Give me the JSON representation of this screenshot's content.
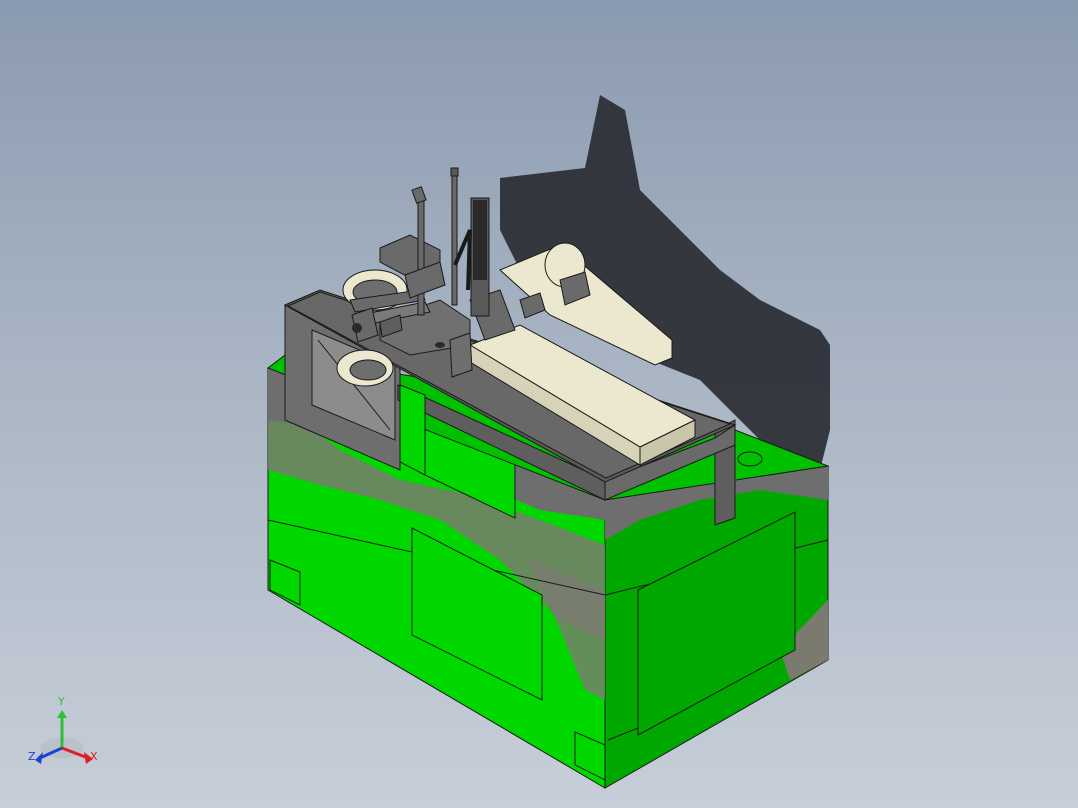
{
  "triad": {
    "y_label": "Y",
    "x_label": "X",
    "z_label": "Z",
    "y_color": "#2bbf3c",
    "x_color": "#e02020",
    "z_color": "#2040d0"
  },
  "model": {
    "base_color": "#00d800",
    "base_dark_color": "#009a00",
    "frame_color": "#6e6e6e",
    "plate_color": "#e8e6cf"
  }
}
